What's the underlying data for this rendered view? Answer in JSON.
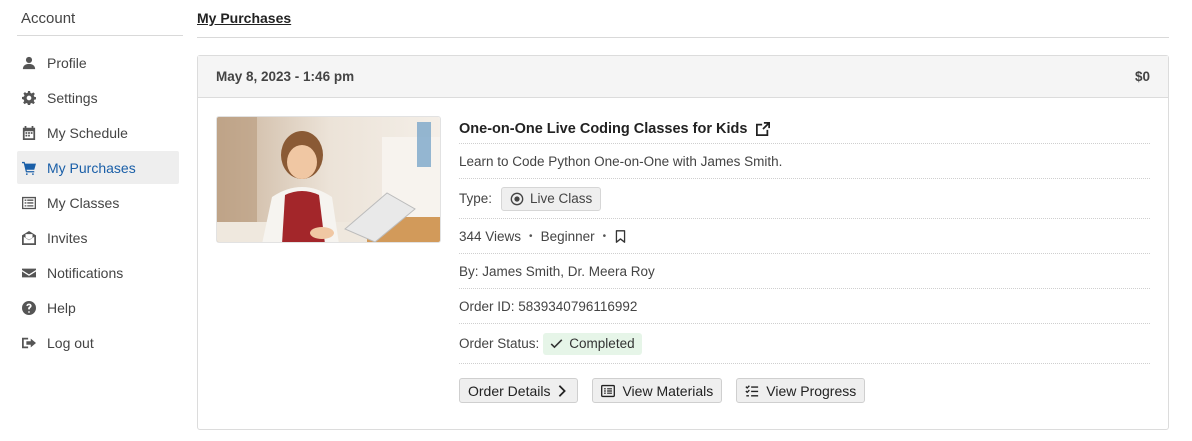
{
  "sidebar": {
    "title": "Account",
    "items": [
      {
        "label": "Profile",
        "icon": "user-icon"
      },
      {
        "label": "Settings",
        "icon": "gear-icon"
      },
      {
        "label": "My Schedule",
        "icon": "calendar-icon"
      },
      {
        "label": "My Purchases",
        "icon": "cart-icon",
        "active": true
      },
      {
        "label": "My Classes",
        "icon": "list-icon"
      },
      {
        "label": "Invites",
        "icon": "envelope-open-icon"
      },
      {
        "label": "Notifications",
        "icon": "envelope-icon"
      },
      {
        "label": "Help",
        "icon": "question-circle-icon"
      },
      {
        "label": "Log out",
        "icon": "sign-out-icon"
      }
    ]
  },
  "page": {
    "title": "My Purchases"
  },
  "purchase": {
    "date": "May 8, 2023 - 1:46 pm",
    "price": "$0",
    "course_title": "One-on-One Live Coding Classes for Kids",
    "description": "Learn to Code Python One-on-One with James Smith.",
    "type_label": "Type:",
    "type_value": "Live Class",
    "views": "344 Views",
    "level": "Beginner",
    "by": "By: James Smith, Dr. Meera Roy",
    "order_id": "Order ID: 5839340796116992",
    "status_label": "Order Status:",
    "status_value": "Completed",
    "status_color": "#e6f5e8"
  },
  "actions": {
    "order_details": "Order Details",
    "view_materials": "View Materials",
    "view_progress": "View Progress"
  },
  "colors": {
    "accent": "#1a5fa8"
  }
}
